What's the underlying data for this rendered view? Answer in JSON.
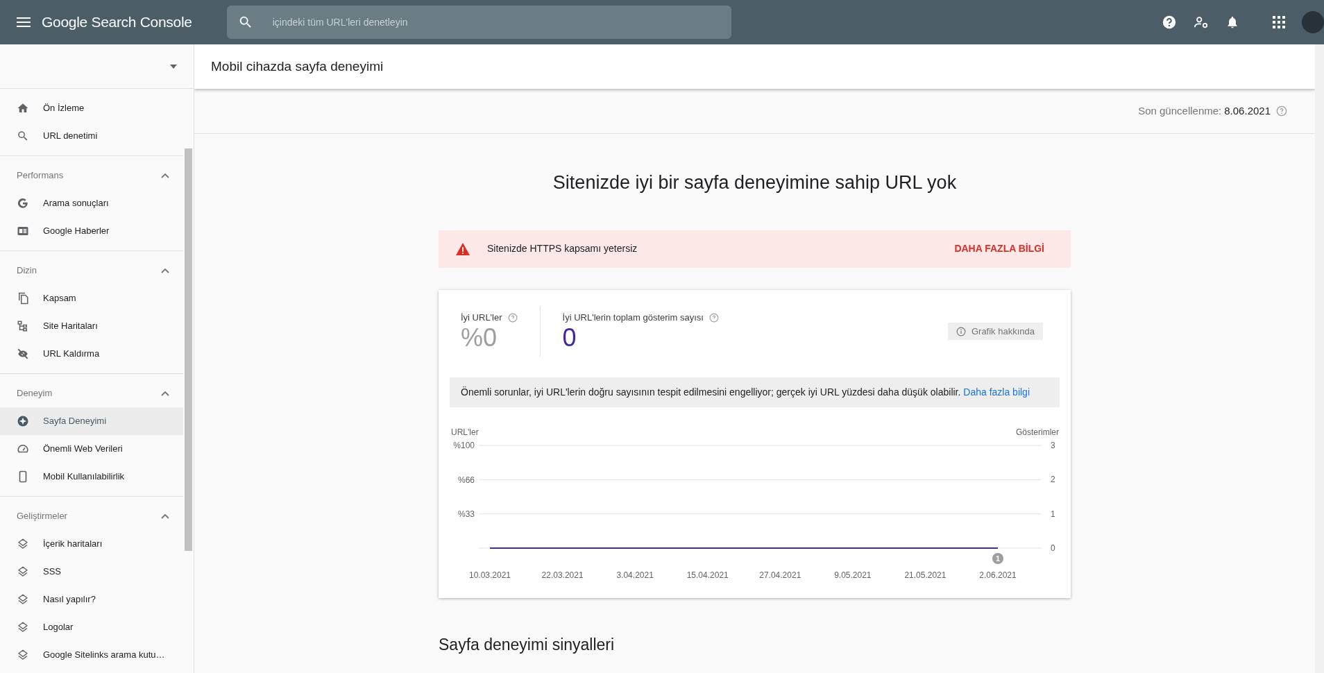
{
  "topbar": {
    "product": "Google Search Console",
    "search": {
      "placeholder": "içindeki tüm URL'leri denetleyin"
    }
  },
  "sidebar": {
    "groups": [
      {
        "items": [
          {
            "label": "Ön İzleme",
            "selected": false
          },
          {
            "label": "URL denetimi",
            "selected": false
          }
        ]
      },
      {
        "title": "Performans",
        "expanded": true,
        "items": [
          {
            "label": "Arama sonuçları",
            "selected": false
          },
          {
            "label": "Google Haberler",
            "selected": false
          }
        ]
      },
      {
        "title": "Dizin",
        "expanded": true,
        "items": [
          {
            "label": "Kapsam",
            "selected": false
          },
          {
            "label": "Site Haritaları",
            "selected": false
          },
          {
            "label": "URL Kaldırma",
            "selected": false
          }
        ]
      },
      {
        "title": "Deneyim",
        "expanded": true,
        "items": [
          {
            "label": "Sayfa Deneyimi",
            "selected": true
          },
          {
            "label": "Önemli Web Verileri",
            "selected": false
          },
          {
            "label": "Mobil Kullanılabilirlik",
            "selected": false
          }
        ]
      },
      {
        "title": "Geliştirmeler",
        "expanded": true,
        "items": [
          {
            "label": "İçerik haritaları",
            "selected": false
          },
          {
            "label": "SSS",
            "selected": false
          },
          {
            "label": "Nasıl yapılır?",
            "selected": false
          },
          {
            "label": "Logolar",
            "selected": false
          },
          {
            "label": "Google Sitelinks arama kutu…",
            "selected": false
          }
        ]
      }
    ]
  },
  "page": {
    "title": "Mobil cihazda sayfa deneyimi",
    "last_updated_label": "Son güncellenme:",
    "last_updated": "8.06.2021",
    "heading": "Sitenizde iyi bir sayfa deneyimine sahip URL yok",
    "alert": {
      "text": "Sitenizde HTTPS kapsamı yetersiz",
      "action": "DAHA FAZLA BİLGİ"
    },
    "card": {
      "metrics": [
        {
          "label": "İyi URL'ler",
          "value": "%0",
          "color": "#9e9e9e"
        },
        {
          "label": "İyi URL'lerin toplam gösterim sayısı",
          "value": "0",
          "color": "#4527a0"
        }
      ],
      "chip": "Grafik hakkında",
      "notice": {
        "text": "Önemli sorunlar, iyi URL'lerin doğru sayısının tespit edilmesini engelliyor; gerçek iyi URL yüzdesi daha düşük olabilir.",
        "link": "Daha fazla bilgi"
      },
      "chart_data": {
        "type": "line",
        "ylabel": "URL'ler",
        "y2label": "Gösterimler",
        "categories": [
          "10.03.2021",
          "22.03.2021",
          "3.04.2021",
          "15.04.2021",
          "27.04.2021",
          "9.05.2021",
          "21.05.2021",
          "2.06.2021"
        ],
        "series": [
          {
            "color": "#4527a0",
            "values": [
              0,
              0,
              0,
              0,
              0,
              0,
              0,
              0
            ]
          }
        ],
        "ylim": [
          0,
          1
        ],
        "yticks": [
          {
            "value": 1,
            "label": "%100"
          },
          {
            "value": 0.66,
            "label": "%66"
          },
          {
            "value": 0.33,
            "label": "%33"
          }
        ],
        "y2lim": [
          0,
          3
        ],
        "y2ticks": [
          3,
          2,
          1,
          0
        ],
        "annotations": [
          "1"
        ]
      }
    },
    "section_heading": "Sayfa deneyimi sinyalleri"
  }
}
